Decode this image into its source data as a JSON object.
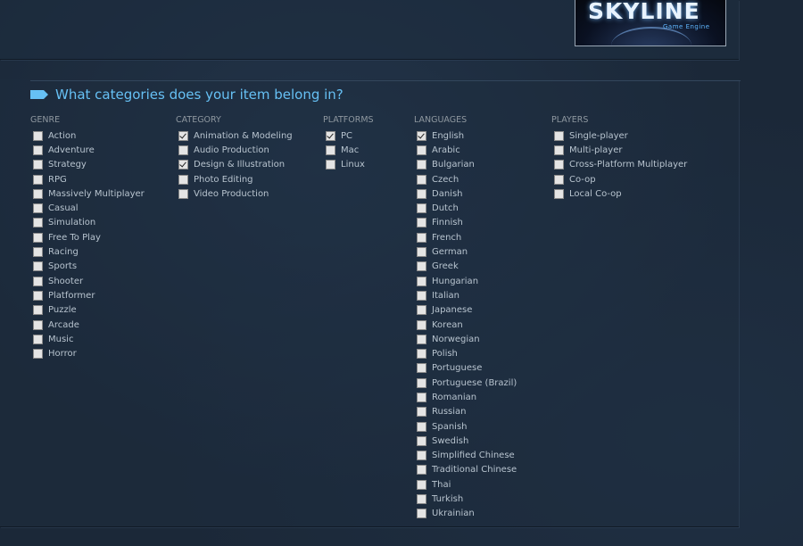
{
  "preview": {
    "logo_text": "SKYLINE",
    "logo_sub": "Game Engine"
  },
  "section": {
    "title": "What categories does your item belong in?"
  },
  "colors": {
    "accent": "#66c0f4",
    "background": "#1b2838",
    "label": "#b8c4cf",
    "header": "#8f98a0"
  },
  "columns": [
    {
      "key": "genre",
      "header": "GENRE",
      "items": [
        {
          "label": "Action",
          "checked": false
        },
        {
          "label": "Adventure",
          "checked": false
        },
        {
          "label": "Strategy",
          "checked": false
        },
        {
          "label": "RPG",
          "checked": false
        },
        {
          "label": "Massively Multiplayer",
          "checked": false
        },
        {
          "label": "Casual",
          "checked": false
        },
        {
          "label": "Simulation",
          "checked": false
        },
        {
          "label": "Free To Play",
          "checked": false
        },
        {
          "label": "Racing",
          "checked": false
        },
        {
          "label": "Sports",
          "checked": false
        },
        {
          "label": "Shooter",
          "checked": false
        },
        {
          "label": "Platformer",
          "checked": false
        },
        {
          "label": "Puzzle",
          "checked": false
        },
        {
          "label": "Arcade",
          "checked": false
        },
        {
          "label": "Music",
          "checked": false
        },
        {
          "label": "Horror",
          "checked": false
        }
      ]
    },
    {
      "key": "category",
      "header": "CATEGORY",
      "items": [
        {
          "label": "Animation & Modeling",
          "checked": true
        },
        {
          "label": "Audio Production",
          "checked": false
        },
        {
          "label": "Design & Illustration",
          "checked": true
        },
        {
          "label": "Photo Editing",
          "checked": false
        },
        {
          "label": "Video Production",
          "checked": false
        }
      ]
    },
    {
      "key": "platforms",
      "header": "PLATFORMS",
      "items": [
        {
          "label": "PC",
          "checked": true
        },
        {
          "label": "Mac",
          "checked": false
        },
        {
          "label": "Linux",
          "checked": false
        }
      ]
    },
    {
      "key": "languages",
      "header": "LANGUAGES",
      "items": [
        {
          "label": "English",
          "checked": true
        },
        {
          "label": "Arabic",
          "checked": false
        },
        {
          "label": "Bulgarian",
          "checked": false
        },
        {
          "label": "Czech",
          "checked": false
        },
        {
          "label": "Danish",
          "checked": false
        },
        {
          "label": "Dutch",
          "checked": false
        },
        {
          "label": "Finnish",
          "checked": false
        },
        {
          "label": "French",
          "checked": false
        },
        {
          "label": "German",
          "checked": false
        },
        {
          "label": "Greek",
          "checked": false
        },
        {
          "label": "Hungarian",
          "checked": false
        },
        {
          "label": "Italian",
          "checked": false
        },
        {
          "label": "Japanese",
          "checked": false
        },
        {
          "label": "Korean",
          "checked": false
        },
        {
          "label": "Norwegian",
          "checked": false
        },
        {
          "label": "Polish",
          "checked": false
        },
        {
          "label": "Portuguese",
          "checked": false
        },
        {
          "label": "Portuguese (Brazil)",
          "checked": false
        },
        {
          "label": "Romanian",
          "checked": false
        },
        {
          "label": "Russian",
          "checked": false
        },
        {
          "label": "Spanish",
          "checked": false
        },
        {
          "label": "Swedish",
          "checked": false
        },
        {
          "label": "Simplified Chinese",
          "checked": false
        },
        {
          "label": "Traditional Chinese",
          "checked": false
        },
        {
          "label": "Thai",
          "checked": false
        },
        {
          "label": "Turkish",
          "checked": false
        },
        {
          "label": "Ukrainian",
          "checked": false
        }
      ]
    },
    {
      "key": "players",
      "header": "PLAYERS",
      "items": [
        {
          "label": "Single-player",
          "checked": false
        },
        {
          "label": "Multi-player",
          "checked": false
        },
        {
          "label": "Cross-Platform Multiplayer",
          "checked": false
        },
        {
          "label": "Co-op",
          "checked": false
        },
        {
          "label": "Local Co-op",
          "checked": false
        }
      ]
    }
  ]
}
